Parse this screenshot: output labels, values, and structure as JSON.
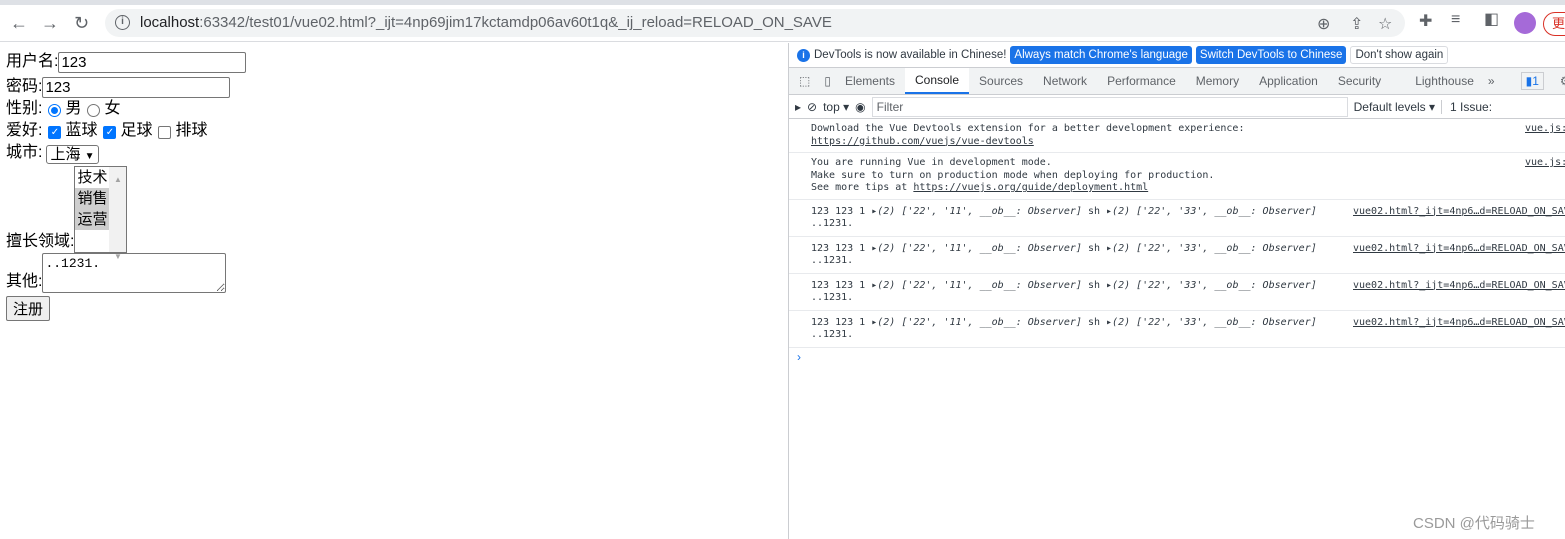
{
  "browser": {
    "url_host": "localhost",
    "url_rest": ":63342/test01/vue02.html?_ijt=4np69jim17kctamdp06av60t1q&_ij_reload=RELOAD_ON_SAVE",
    "update_label": "更"
  },
  "form": {
    "username_label": "用户名:",
    "username_value": "123",
    "password_label": "密码:",
    "password_value": "123",
    "gender_label": "性别:",
    "gender_options": [
      "男",
      "女"
    ],
    "gender_selected": "男",
    "hobby_label": "爱好:",
    "hobbies": [
      {
        "label": "蓝球",
        "checked": true
      },
      {
        "label": "足球",
        "checked": true
      },
      {
        "label": "排球",
        "checked": false
      }
    ],
    "city_label": "城市:",
    "city_value": "上海",
    "field_label": "擅长领域:",
    "field_options": [
      {
        "label": "技术",
        "selected": false
      },
      {
        "label": "销售",
        "selected": true
      },
      {
        "label": "运营",
        "selected": true
      }
    ],
    "other_label": "其他:",
    "other_value": "..1231.",
    "submit_label": "注册"
  },
  "devtools": {
    "info_text": "DevTools is now available in Chinese!",
    "btn_match": "Always match Chrome's language",
    "btn_switch": "Switch DevTools to Chinese",
    "btn_dismiss": "Don't show again",
    "tabs": [
      "Elements",
      "Console",
      "Sources",
      "Network",
      "Performance",
      "Memory",
      "Application",
      "Security",
      "Lighthouse"
    ],
    "active_tab": "Console",
    "issues_badge": "1",
    "context": "top",
    "filter_placeholder": "Filter",
    "levels": "Default levels",
    "issues": "1 Issue:",
    "messages": {
      "m1_text": "Download the Vue Devtools extension for a better development experience:",
      "m1_link": "https://github.com/vuejs/vue-devtools",
      "m1_src": "vue.js:",
      "m2_line1": "You are running Vue in development mode.",
      "m2_line2": "Make sure to turn on production mode when deploying for production.",
      "m2_prefix": "See more tips at ",
      "m2_link": "https://vuejs.org/guide/deployment.html",
      "m2_src": "vue.js:",
      "log_prefix": "123 123 1 ▸",
      "log_arr1_a": "(2) ['22', '11', __ob__: Observer]",
      "log_mid": " sh ▸",
      "log_arr2": "(2) ['22', '33', __ob__: Observer]",
      "log_line2": "..1231.",
      "log_src": "vue02.html?_ijt=4np6…d=RELOAD_ON_SAVE"
    }
  },
  "watermark": "CSDN @代码骑士"
}
